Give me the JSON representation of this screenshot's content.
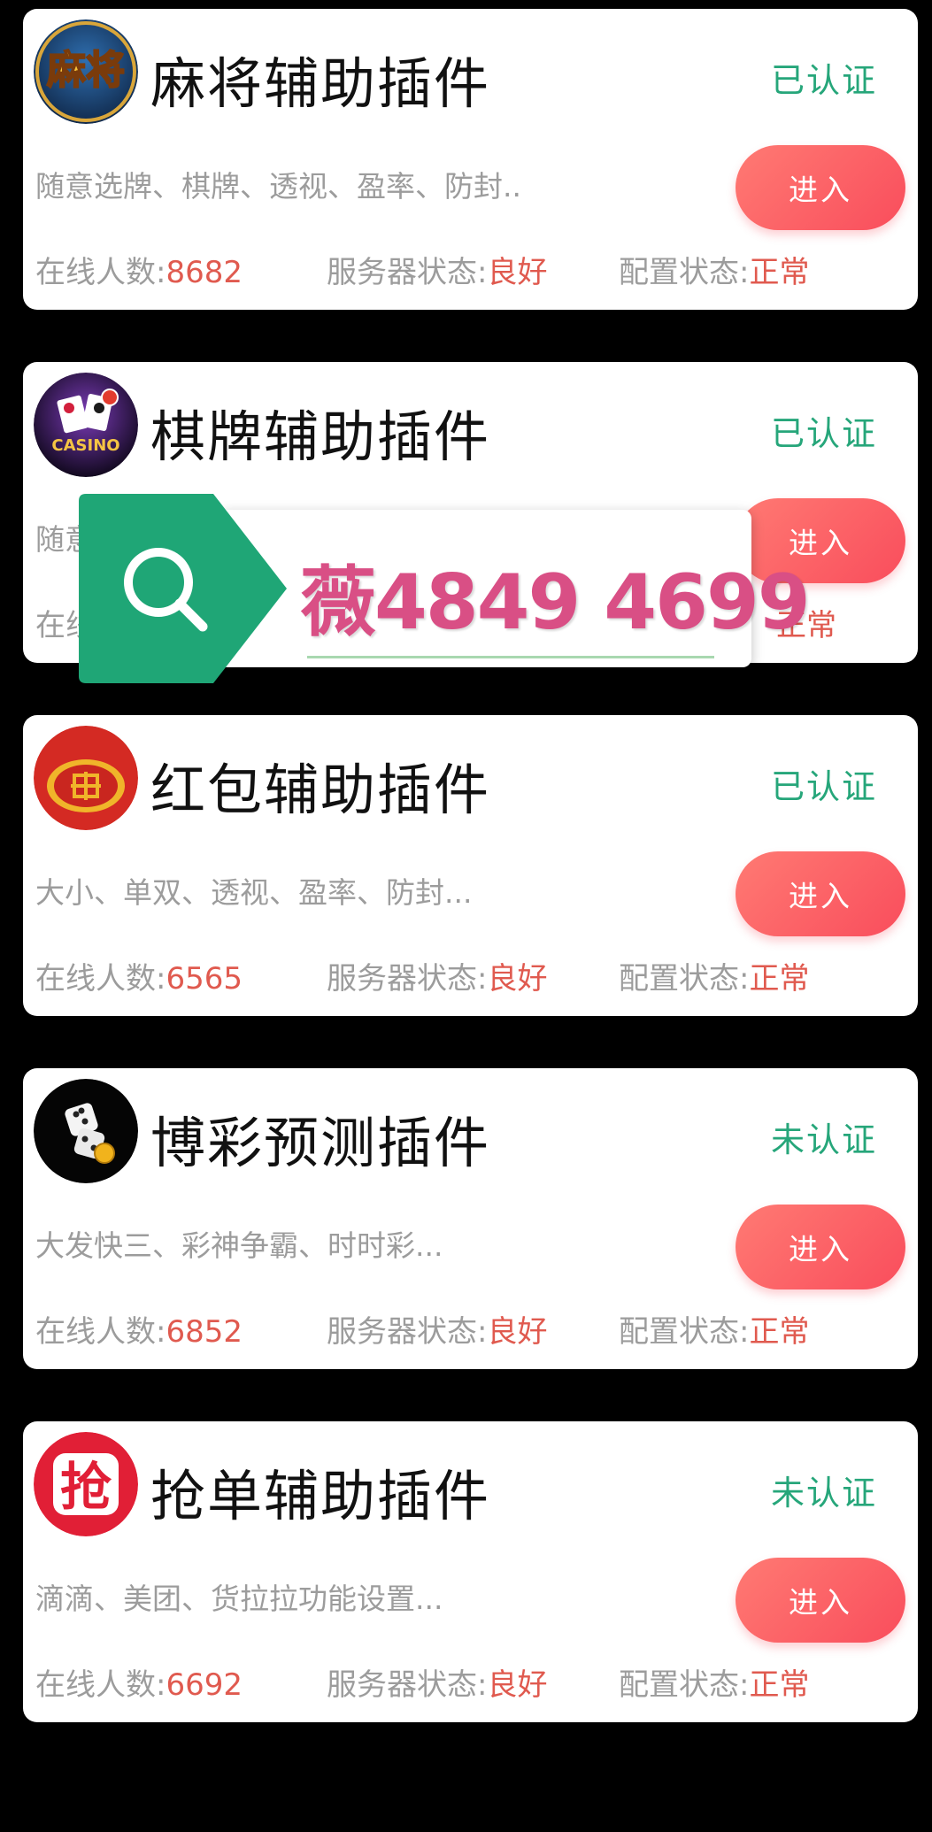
{
  "colors": {
    "verified_green": "#26a67a",
    "button_red": "#f94d5c",
    "value_red": "#e05a4f",
    "overlay_green": "#1fa676",
    "overlay_pink": "#d94f85"
  },
  "cards": [
    {
      "title": "麻将辅助插件",
      "cert_status": "已认证",
      "description": "随意选牌、棋牌、透视、盈率、防封..",
      "button_label": "进入",
      "online_label": "在线人数:",
      "online_count": "8682",
      "server_label": "服务器状态:",
      "server_status": "良好",
      "config_label": "配置状态:",
      "config_status": "正常",
      "logo_text": "麻将",
      "icon": "mahjong-logo-icon"
    },
    {
      "title": "棋牌辅助插件",
      "cert_status": "已认证",
      "description": "随意",
      "button_label": "进入",
      "online_label": "在线",
      "config_status": "正常",
      "logo_text": "CASINO",
      "icon": "casino-logo-icon"
    },
    {
      "title": "红包辅助插件",
      "cert_status": "已认证",
      "description": "大小、单双、透视、盈率、防封...",
      "button_label": "进入",
      "online_label": "在线人数:",
      "online_count": "6565",
      "server_label": "服务器状态:",
      "server_status": "良好",
      "config_label": "配置状态:",
      "config_status": "正常",
      "icon": "red-envelope-logo-icon"
    },
    {
      "title": "博彩预测插件",
      "cert_status": "未认证",
      "description": "大发快三、彩神争霸、时时彩...",
      "button_label": "进入",
      "online_label": "在线人数:",
      "online_count": "6852",
      "server_label": "服务器状态:",
      "server_status": "良好",
      "config_label": "配置状态:",
      "config_status": "正常",
      "icon": "dice-logo-icon"
    },
    {
      "title": "抢单辅助插件",
      "cert_status": "未认证",
      "description": "滴滴、美团、货拉拉功能设置...",
      "button_label": "进入",
      "online_label": "在线人数:",
      "online_count": "6692",
      "server_label": "服务器状态:",
      "server_status": "良好",
      "config_label": "配置状态:",
      "config_status": "正常",
      "logo_text": "抢",
      "icon": "grab-order-logo-icon"
    }
  ],
  "overlay": {
    "text": "薇4849 4699",
    "icon": "search-icon"
  }
}
